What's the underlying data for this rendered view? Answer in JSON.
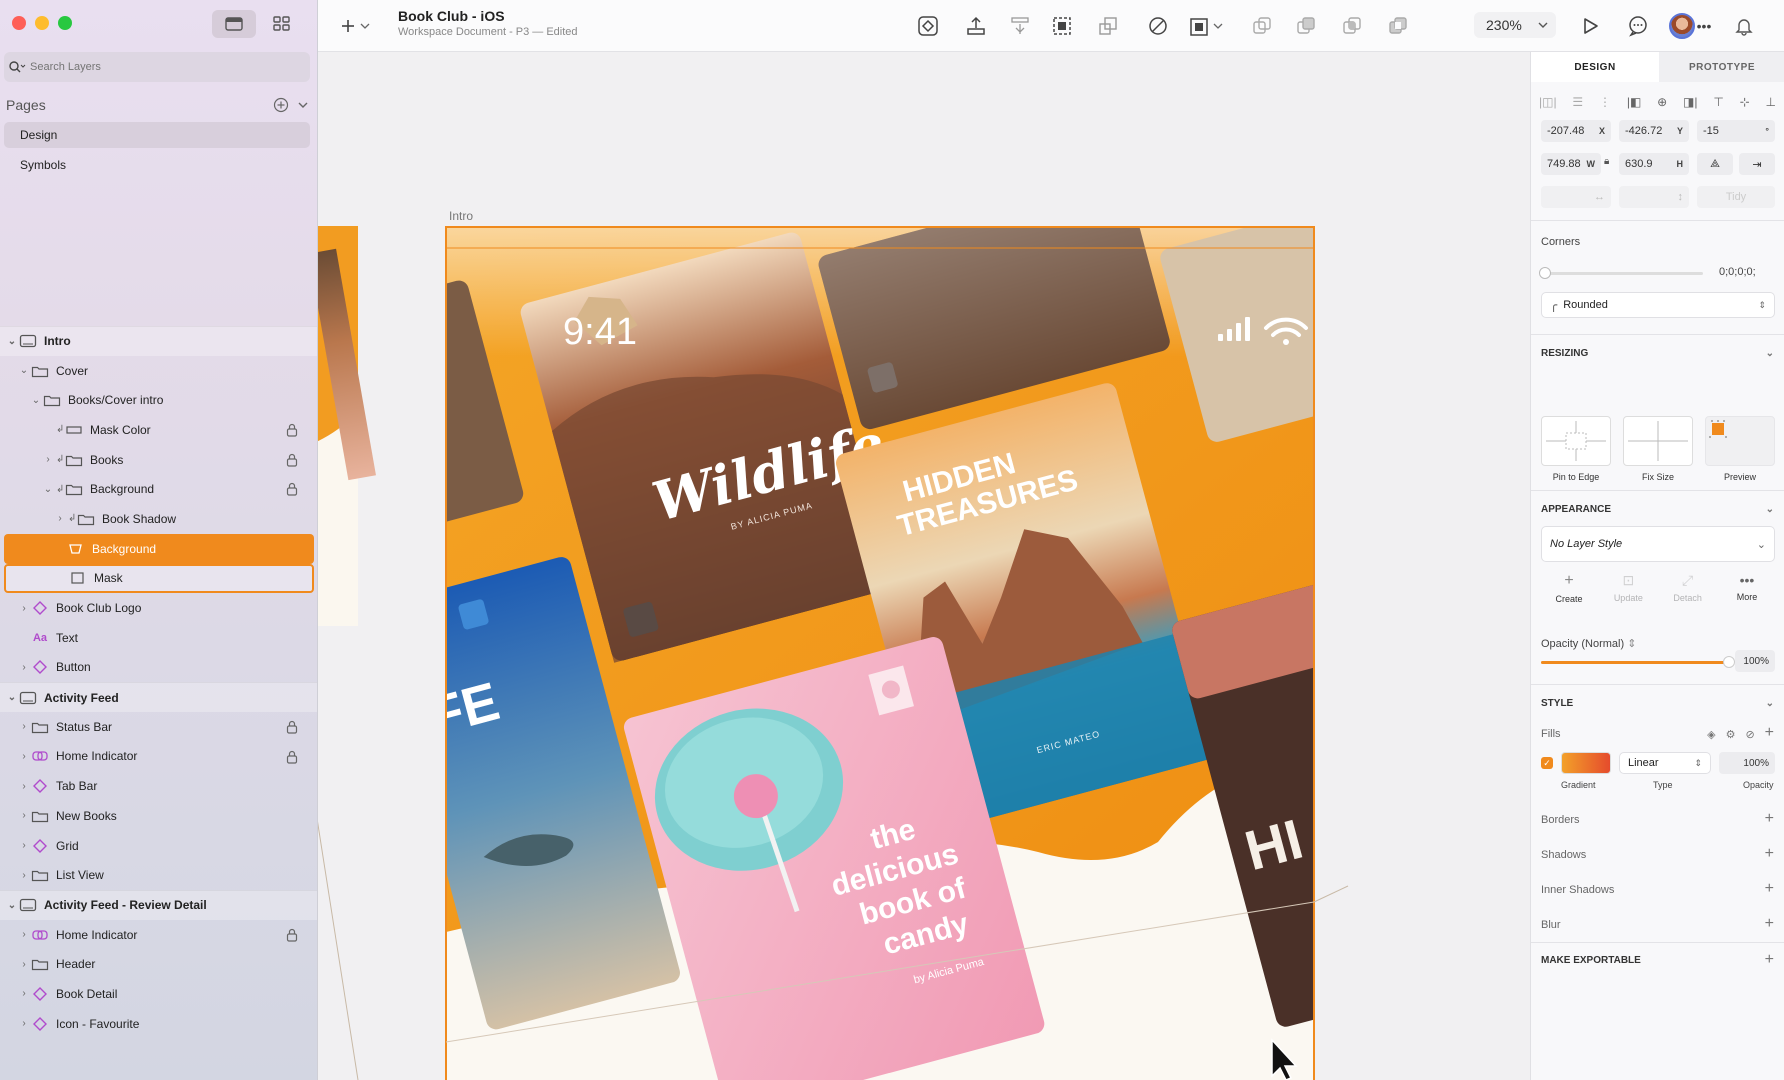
{
  "app": {
    "title": "Book Club - iOS",
    "subtitle": "Workspace Document - P3 — Edited"
  },
  "sidebar": {
    "search_placeholder": "Search Layers",
    "pages_label": "Pages",
    "pages": [
      "Design",
      "Symbols"
    ],
    "tree": [
      {
        "label": "Intro",
        "level": 0,
        "kind": "group",
        "chev": "open",
        "icon": "artboard-icon"
      },
      {
        "label": "Cover",
        "level": 1,
        "chev": "open",
        "icon": "folder-icon"
      },
      {
        "label": "Books/Cover intro",
        "level": 2,
        "chev": "open",
        "icon": "folder-icon"
      },
      {
        "label": "Mask Color",
        "level": 3,
        "icon": "rectangle-icon",
        "clip": true,
        "lock": true
      },
      {
        "label": "Books",
        "level": 3,
        "chev": "closed",
        "icon": "folder-icon",
        "clip": true,
        "lock": true
      },
      {
        "label": "Background",
        "level": 3,
        "chev": "open",
        "icon": "folder-icon",
        "clip": true,
        "lock": true
      },
      {
        "label": "Book Shadow",
        "level": 4,
        "chev": "closed",
        "icon": "folder-icon",
        "clip": true
      },
      {
        "label": "Background",
        "level": 4,
        "icon": "shape-icon",
        "selected": true
      },
      {
        "label": "Mask",
        "level": 4,
        "icon": "square-icon",
        "mask": true
      },
      {
        "label": "Book Club Logo",
        "level": 1,
        "chev": "closed",
        "icon": "symbol-icon"
      },
      {
        "label": "Text",
        "level": 1,
        "icon": "text-icon"
      },
      {
        "label": "Button",
        "level": 1,
        "chev": "closed",
        "icon": "symbol-icon"
      },
      {
        "label": "Activity Feed",
        "level": 0,
        "kind": "group",
        "chev": "open",
        "icon": "artboard-icon"
      },
      {
        "label": "Status Bar",
        "level": 1,
        "chev": "closed",
        "icon": "folder-icon",
        "lock": true
      },
      {
        "label": "Home Indicator",
        "level": 1,
        "chev": "closed",
        "icon": "symbol-link-icon",
        "lock": true
      },
      {
        "label": "Tab Bar",
        "level": 1,
        "chev": "closed",
        "icon": "symbol-icon"
      },
      {
        "label": "New Books",
        "level": 1,
        "chev": "closed",
        "icon": "folder-icon"
      },
      {
        "label": "Grid",
        "level": 1,
        "chev": "closed",
        "icon": "symbol-icon"
      },
      {
        "label": "List View",
        "level": 1,
        "chev": "closed",
        "icon": "folder-icon"
      },
      {
        "label": "Activity Feed - Review Detail",
        "level": 0,
        "kind": "group",
        "chev": "open",
        "icon": "artboard-icon"
      },
      {
        "label": "Home Indicator",
        "level": 1,
        "chev": "closed",
        "icon": "symbol-link-icon",
        "lock": true
      },
      {
        "label": "Header",
        "level": 1,
        "chev": "closed",
        "icon": "folder-icon"
      },
      {
        "label": "Book Detail",
        "level": 1,
        "chev": "closed",
        "icon": "symbol-icon"
      },
      {
        "label": "Icon - Favourite",
        "level": 1,
        "chev": "closed",
        "icon": "symbol-icon"
      }
    ]
  },
  "toolbar": {
    "zoom": "230%"
  },
  "canvas": {
    "artboard_label": "Intro",
    "status_time": "9:41",
    "books": {
      "wildlife_title": "Wildlife",
      "wildlife_author": "BY ALICIA PUMA",
      "treasures_title_1": "HIDDEN",
      "treasures_title_2": "TREASURES",
      "treasures_author": "ERIC MATEO",
      "candy_1": "the",
      "candy_2": "delicious",
      "candy_3": "book of",
      "candy_4": "candy",
      "candy_author": "by Alicia Puma",
      "left_fragment": "IFE",
      "right_fragment": "HI"
    }
  },
  "inspector": {
    "tabs": [
      "DESIGN",
      "PROTOTYPE"
    ],
    "x": "-207.48",
    "x_unit": "X",
    "y": "-426.72",
    "y_unit": "Y",
    "rotation": "-15",
    "rotation_unit": "°",
    "w": "749.88",
    "w_unit": "W",
    "h": "630.9",
    "h_unit": "H",
    "tidy": "Tidy",
    "corners_label": "Corners",
    "corners_value": "0;0;0;0;",
    "corner_style": "Rounded",
    "resizing_label": "RESIZING",
    "resizing_options": [
      "Pin to Edge",
      "Fix Size",
      "Preview"
    ],
    "appearance_label": "APPEARANCE",
    "layer_style": "No Layer Style",
    "style_actions": [
      "Create",
      "Update",
      "Detach",
      "More"
    ],
    "opacity_label": "Opacity (Normal)",
    "opacity_value": "100%",
    "opacity_level": 1.0,
    "style_label": "STYLE",
    "fills_label": "Fills",
    "fill_type": "Linear",
    "fill_opacity": "100%",
    "fill_sublabels": [
      "Gradient",
      "Type",
      "Opacity"
    ],
    "sections": [
      "Borders",
      "Shadows",
      "Inner Shadows",
      "Blur"
    ],
    "exportable": "MAKE EXPORTABLE"
  },
  "colors": {
    "accent": "#f08a1d",
    "artboard_orange": "#f3a01f"
  }
}
